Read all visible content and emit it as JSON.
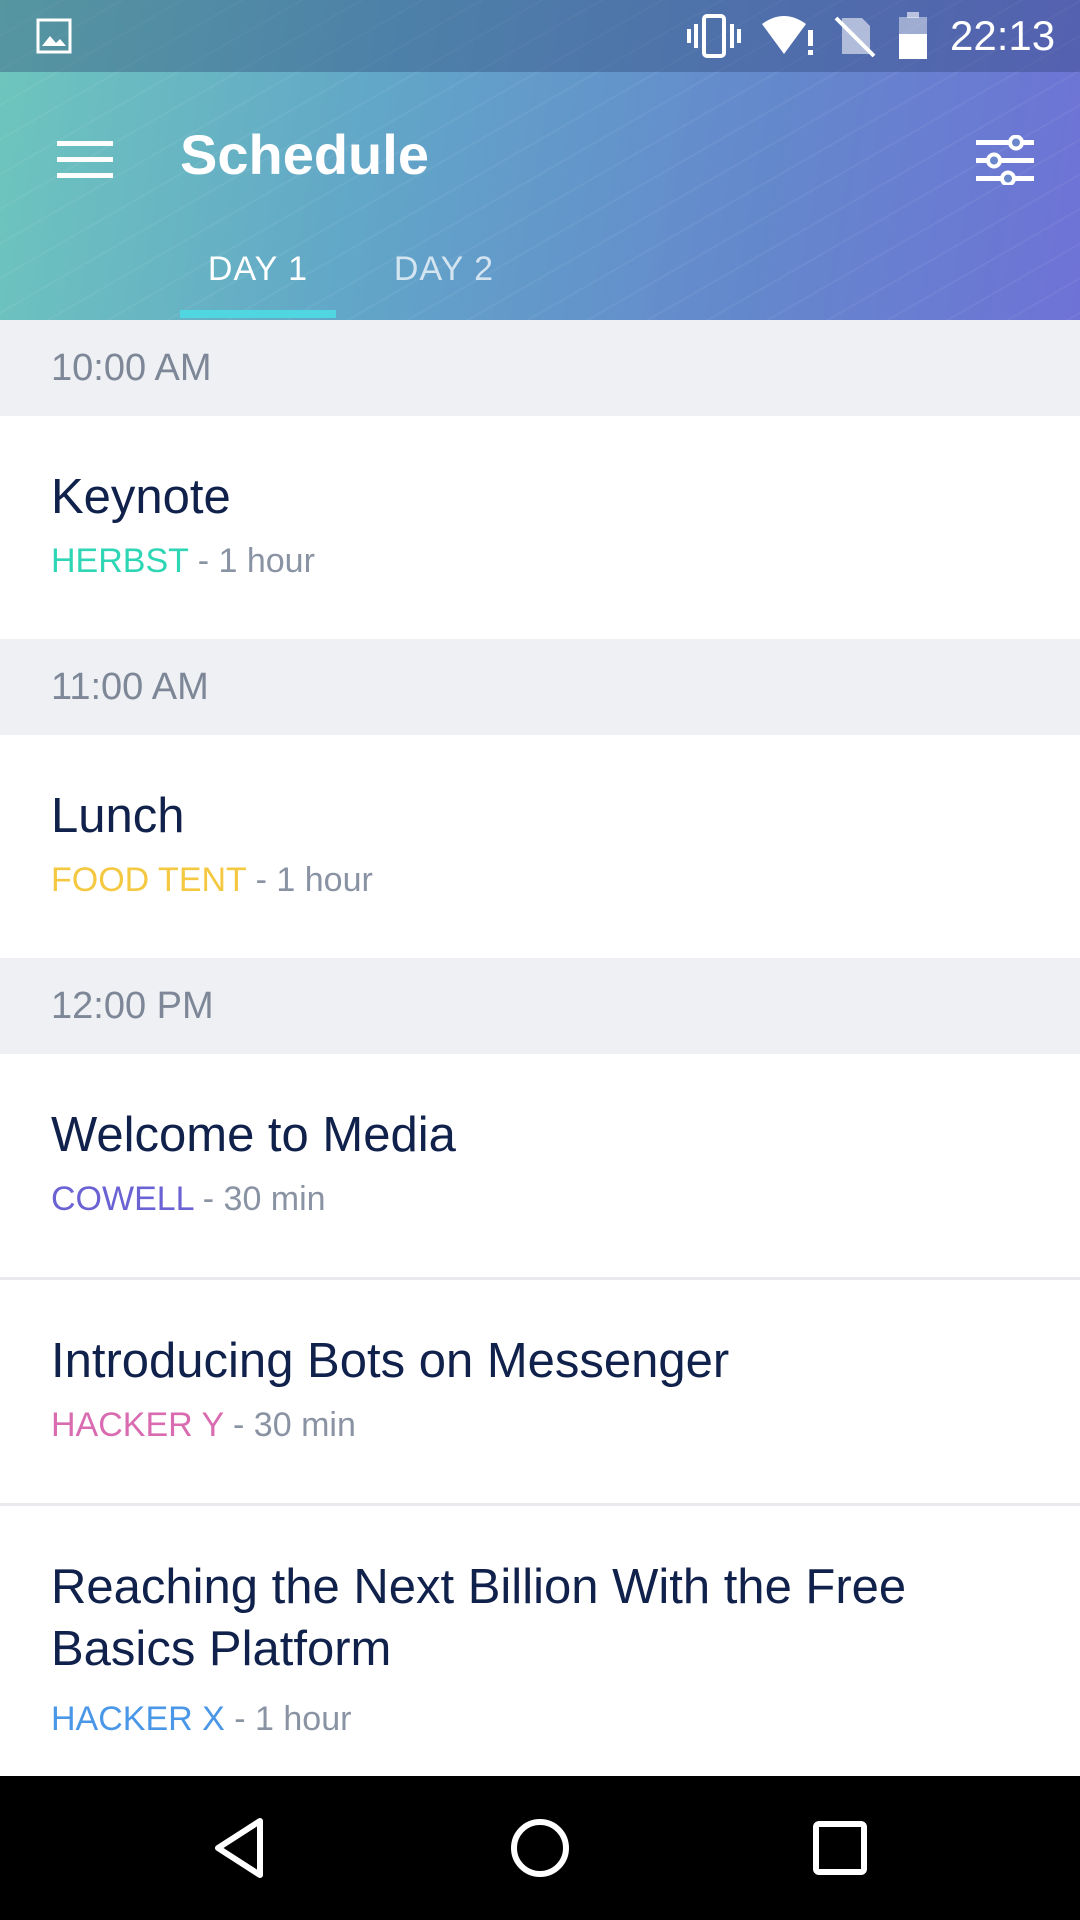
{
  "status_bar": {
    "time": "22:13",
    "icons": [
      "image-icon",
      "vibrate-icon",
      "wifi-alert-icon",
      "no-sim-icon",
      "battery-icon"
    ]
  },
  "app_bar": {
    "title": "Schedule",
    "menu_icon": "hamburger-menu-icon",
    "filter_icon": "filter-sliders-icon"
  },
  "tabs": [
    {
      "label": "DAY 1",
      "selected": true
    },
    {
      "label": "DAY 2",
      "selected": false
    }
  ],
  "colors": {
    "accent_indicator": "#4fd6e0",
    "title_text": "#10214b",
    "venue_herbst": "#2fd6b5",
    "venue_food_tent": "#f5c842",
    "venue_cowell": "#6b63d3",
    "venue_hacker_y": "#d96bb0",
    "venue_hacker_x": "#4a97e8"
  },
  "schedule": [
    {
      "time": "10:00 AM",
      "events": [
        {
          "title": "Keynote",
          "venue": "HERBST",
          "duration": " - 1 hour"
        }
      ]
    },
    {
      "time": "11:00 AM",
      "events": [
        {
          "title": "Lunch",
          "venue": "FOOD TENT",
          "duration": " - 1 hour"
        }
      ]
    },
    {
      "time": "12:00 PM",
      "events": [
        {
          "title": "Welcome to Media",
          "venue": "COWELL",
          "duration": " - 30 min"
        },
        {
          "title": "Introducing Bots on Messenger",
          "venue": "HACKER Y",
          "duration": " - 30 min"
        },
        {
          "title": "Reaching the Next Billion With the Free Basics Platform",
          "venue": "HACKER X",
          "duration": " - 1 hour"
        }
      ]
    }
  ],
  "nav_bar": {
    "buttons": [
      "back-icon",
      "home-icon",
      "recents-icon"
    ]
  }
}
